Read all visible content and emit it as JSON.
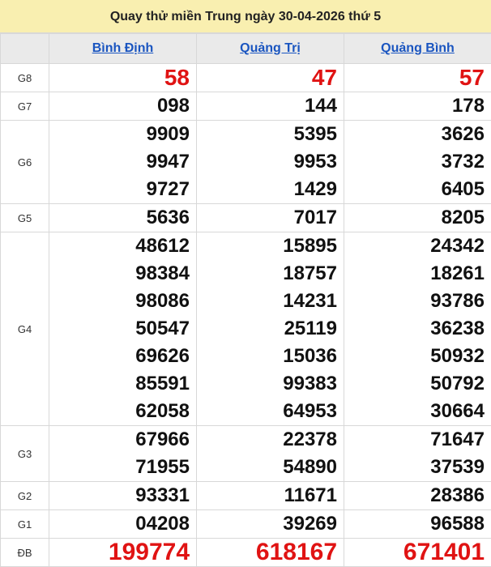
{
  "title": "Quay thử miền Trung ngày 30-04-2026 thứ 5",
  "provinces": [
    "Bình Định",
    "Quảng Trị",
    "Quảng Bình"
  ],
  "prizes": {
    "g8": {
      "label": "G8",
      "values": [
        [
          "58"
        ],
        [
          "47"
        ],
        [
          "57"
        ]
      ]
    },
    "g7": {
      "label": "G7",
      "values": [
        [
          "098"
        ],
        [
          "144"
        ],
        [
          "178"
        ]
      ]
    },
    "g6": {
      "label": "G6",
      "values": [
        [
          "9909",
          "9947",
          "9727"
        ],
        [
          "5395",
          "9953",
          "1429"
        ],
        [
          "3626",
          "3732",
          "6405"
        ]
      ]
    },
    "g5": {
      "label": "G5",
      "values": [
        [
          "5636"
        ],
        [
          "7017"
        ],
        [
          "8205"
        ]
      ]
    },
    "g4": {
      "label": "G4",
      "values": [
        [
          "48612",
          "98384",
          "98086",
          "50547",
          "69626",
          "85591",
          "62058"
        ],
        [
          "15895",
          "18757",
          "14231",
          "25119",
          "15036",
          "99383",
          "64953"
        ],
        [
          "24342",
          "18261",
          "93786",
          "36238",
          "50932",
          "50792",
          "30664"
        ]
      ]
    },
    "g3": {
      "label": "G3",
      "values": [
        [
          "67966",
          "71955"
        ],
        [
          "22378",
          "54890"
        ],
        [
          "71647",
          "37539"
        ]
      ]
    },
    "g2": {
      "label": "G2",
      "values": [
        [
          "93331"
        ],
        [
          "11671"
        ],
        [
          "28386"
        ]
      ]
    },
    "g1": {
      "label": "G1",
      "values": [
        [
          "04208"
        ],
        [
          "39269"
        ],
        [
          "96588"
        ]
      ]
    },
    "db": {
      "label": "ĐB",
      "values": [
        [
          "199774"
        ],
        [
          "618167"
        ],
        [
          "671401"
        ]
      ]
    }
  },
  "colors": {
    "header_bg": "#f9efb0",
    "link": "#1a55c0",
    "highlight": "#e01313"
  }
}
